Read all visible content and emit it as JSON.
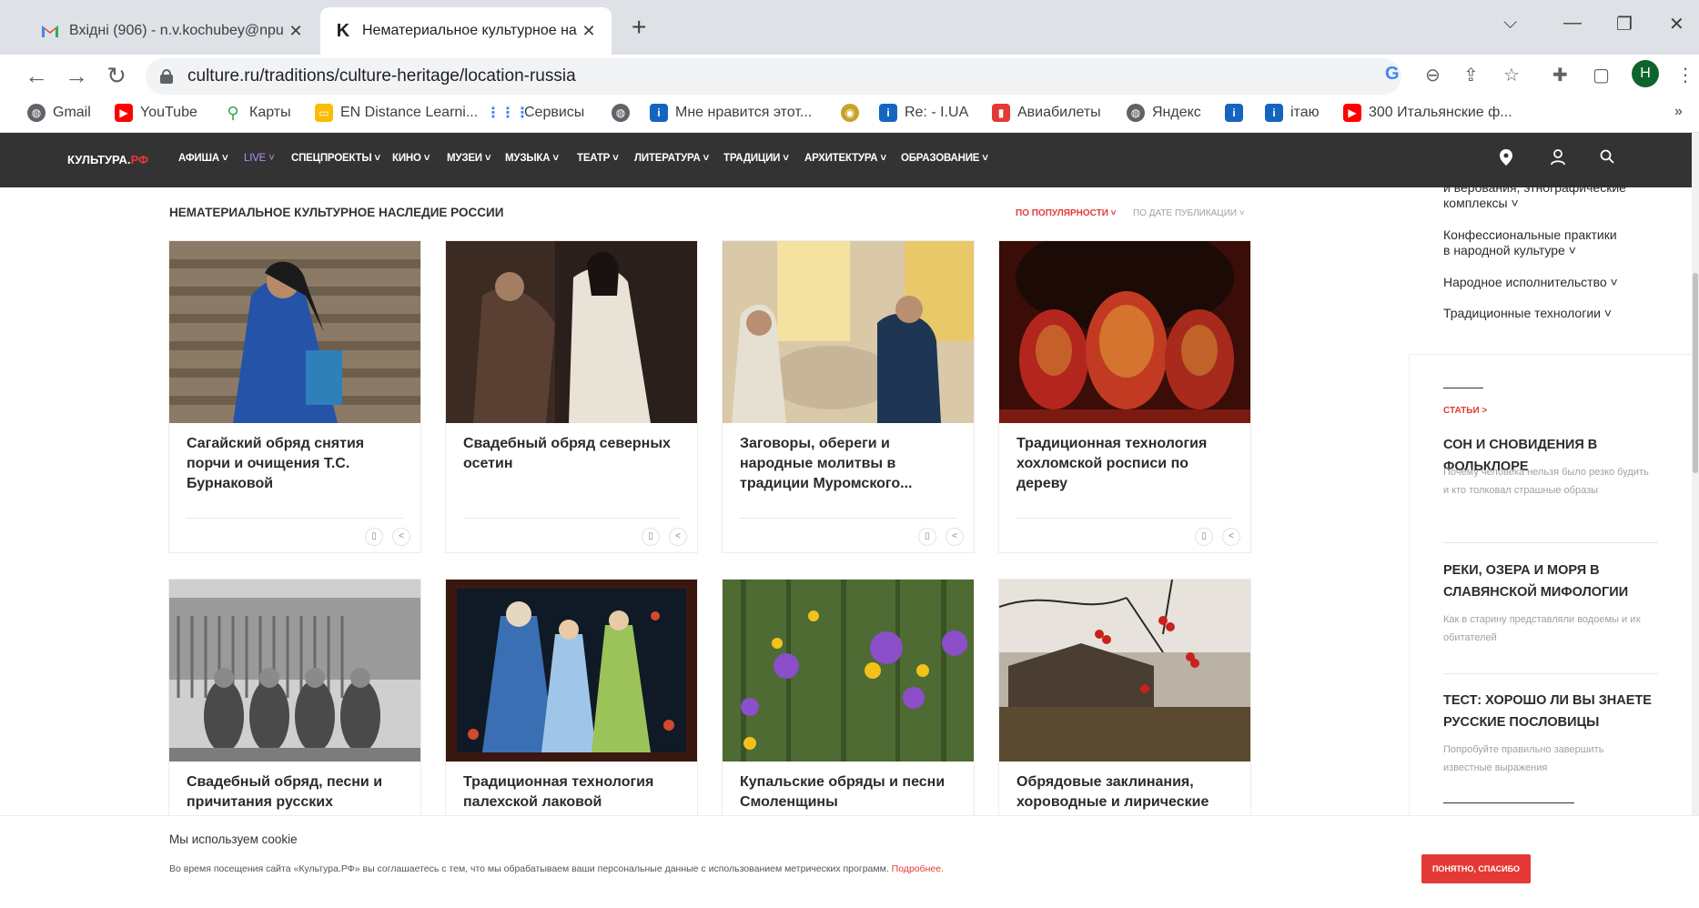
{
  "browser": {
    "tabs": [
      {
        "title": "Вхідні (906) - n.v.kochubey@npu",
        "icon": "gmail-icon",
        "active": false
      },
      {
        "title": "Нематериальное культурное на",
        "icon": "kultura-k-icon",
        "active": true
      }
    ],
    "url": "culture.ru/traditions/culture-heritage/location-russia",
    "profile_initial": "Н",
    "bookmarks": [
      {
        "label": "Gmail",
        "icon": "globe-icon"
      },
      {
        "label": "YouTube",
        "icon": "youtube-icon"
      },
      {
        "label": "Карты",
        "icon": "maps-pin-icon"
      },
      {
        "label": "EN Distance Learni...",
        "icon": "folder-icon"
      },
      {
        "label": "Сервисы",
        "icon": "apps-grid-icon"
      },
      {
        "label": "",
        "icon": "globe-icon"
      },
      {
        "label": "Мне нравится этот...",
        "icon": "info-icon"
      },
      {
        "label": "",
        "icon": "coin-icon"
      },
      {
        "label": "Re: - I.UA",
        "icon": "info-icon"
      },
      {
        "label": "Авиабилеты",
        "icon": "bag-icon"
      },
      {
        "label": "Яндекс",
        "icon": "globe-icon"
      },
      {
        "label": "",
        "icon": "info-icon"
      },
      {
        "label": "ітаю",
        "icon": "info-icon"
      },
      {
        "label": "300 Итальянские ф...",
        "icon": "youtube-icon"
      }
    ],
    "more_bookmarks": "»"
  },
  "site": {
    "logo_main": "КУЛЬТУРА.",
    "logo_suffix": "РФ",
    "nav": [
      "АФИША ˅",
      "LIVE ˅",
      "СПЕЦПРОЕКТЫ ˅",
      "КИНО ˅",
      "МУЗЕИ ˅",
      "МУЗЫКА ˅",
      "ТЕАТР ˅",
      "ЛИТЕРАТУРА ˅",
      "ТРАДИЦИИ ˅",
      "АРХИТЕКТУРА ˅",
      "ОБРАЗОВАНИЕ ˅"
    ]
  },
  "main": {
    "section_title": "НЕМАТЕРИАЛЬНОЕ КУЛЬТУРНОЕ НАСЛЕДИЕ РОССИИ",
    "sort_popular": "ПО ПОПУЛЯРНОСТИ ˅",
    "sort_date": "ПО ДАТЕ ПУБЛИКАЦИИ ˅",
    "cards": [
      {
        "title": "Сагайский обряд снятия порчи и очищения Т.С. Бурнаковой"
      },
      {
        "title": "Свадебный обряд северных осетин"
      },
      {
        "title": "Заговоры, обереги и народные молитвы в традиции Муромского..."
      },
      {
        "title": "Традиционная технология хохломской росписи по дереву"
      },
      {
        "title": "Свадебный обряд, песни и причитания русских"
      },
      {
        "title": "Традиционная технология палехской лаковой"
      },
      {
        "title": "Купальские обряды и песни Смоленщины"
      },
      {
        "title": "Обрядовые заклинания, хороводные и лирические"
      }
    ]
  },
  "sidebar": {
    "categories": [
      "и верования, этнографические комплексы ˅",
      "Конфессиональные практики в народной культуре ˅",
      "Народное исполнительство ˅",
      "Традиционные технологии ˅"
    ],
    "articles_label": "СТАТЬИ >",
    "articles": [
      {
        "title": "СОН И СНОВИДЕНИЯ В ФОЛЬКЛОРЕ",
        "desc": "Почему человека нельзя было резко будить и кто толковал страшные образы"
      },
      {
        "title": "РЕКИ, ОЗЕРА И МОРЯ В СЛАВЯНСКОЙ МИФОЛОГИИ",
        "desc": "Как в старину представляли водоемы и их обитателей"
      },
      {
        "title": "ТЕСТ: ХОРОШО ЛИ ВЫ ЗНАЕТЕ РУССКИЕ ПОСЛОВИЦЫ",
        "desc": "Попробуйте правильно завершить известные выражения"
      }
    ]
  },
  "cookie": {
    "title": "Мы используем cookie",
    "text": "Во время посещения сайта «Культура.РФ» вы соглашаетесь с тем, что мы обрабатываем ваши персональные данные с использованием метрических программ.",
    "link": "Подробнее.",
    "button": "ПОНЯТНО, СПАСИБО"
  },
  "colors": {
    "accent": "#e53935",
    "nav_bg": "#333333",
    "live": "#b48cf0"
  }
}
